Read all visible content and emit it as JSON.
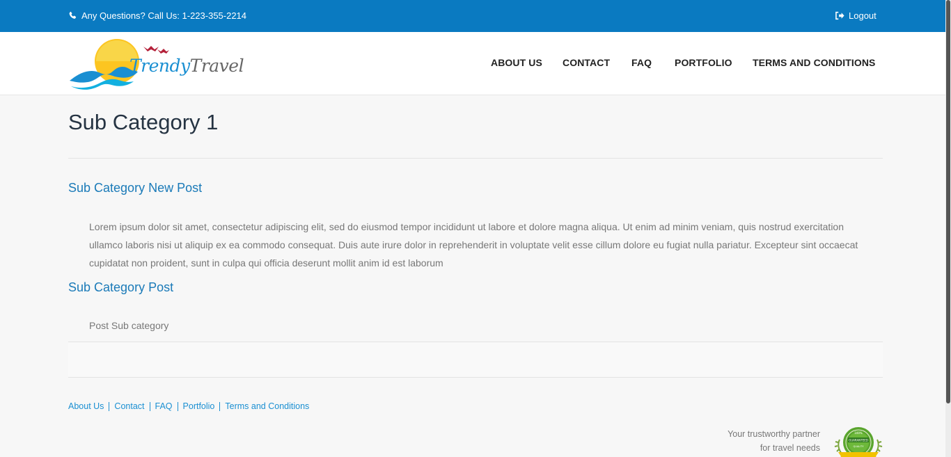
{
  "topbar": {
    "phone_text": "Any Questions? Call Us: 1-223-355-2214",
    "logout_label": "Logout",
    "bg_color": "#0a7ac1"
  },
  "header": {
    "logo_part1": "Trendy",
    "logo_part2": "Travel",
    "nav": [
      {
        "label": "ABOUT US"
      },
      {
        "label": "CONTACT"
      },
      {
        "label": "FAQ"
      },
      {
        "label": "PORTFOLIO"
      },
      {
        "label": "TERMS AND CONDITIONS"
      }
    ]
  },
  "main": {
    "page_title": "Sub Category 1",
    "posts": [
      {
        "title": "Sub Category New Post",
        "body": "Lorem ipsum dolor sit amet, consectetur adipiscing elit, sed do eiusmod tempor incididunt ut labore et dolore magna aliqua. Ut enim ad minim veniam, quis nostrud exercitation ullamco laboris nisi ut aliquip ex ea commodo consequat. Duis aute irure dolor in reprehenderit in voluptate velit esse cillum dolore eu fugiat nulla pariatur. Excepteur sint occaecat cupidatat non proident, sunt in culpa qui officia deserunt mollit anim id est laborum"
      },
      {
        "title": "Sub Category Post",
        "body": "Post Sub category"
      }
    ]
  },
  "footer": {
    "links": [
      {
        "label": "About Us"
      },
      {
        "label": "Contact"
      },
      {
        "label": "FAQ"
      },
      {
        "label": "Portfolio"
      },
      {
        "label": "Terms and Conditions"
      }
    ],
    "tagline_line1": "Your trustworthy partner",
    "tagline_line2": "for travel needs",
    "seal_text": "100% GUARANTEED QUALITY"
  },
  "icons": {
    "phone": "phone-icon",
    "logout": "sign-out-icon",
    "logo": "sun-waves-birds-logo",
    "seal": "quality-seal-icon"
  },
  "colors": {
    "accent": "#1a7ab8",
    "link": "#1a8fd2",
    "title": "#253342"
  }
}
